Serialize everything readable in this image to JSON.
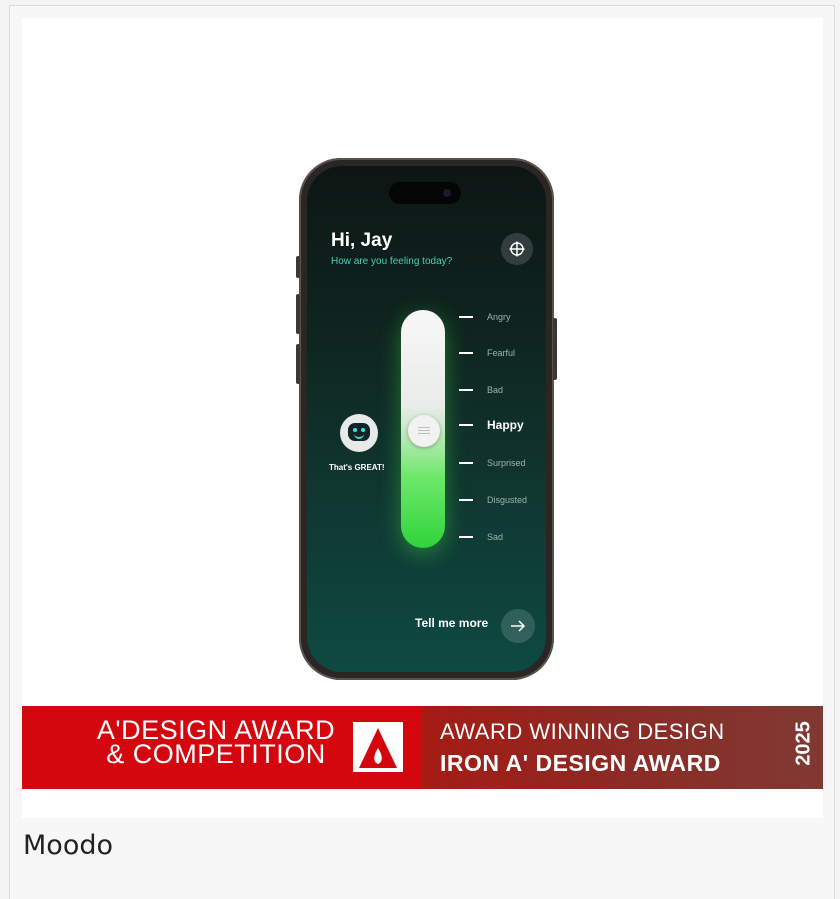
{
  "app": {
    "greeting": "Hi, Jay",
    "subtitle": "How are you feeling today?",
    "settings_icon": "crosshair-icon",
    "moods": [
      "Angry",
      "Fearful",
      "Bad",
      "Happy",
      "Surprised",
      "Disgusted",
      "Sad"
    ],
    "selected_mood": "Happy",
    "robot_caption": "That's GREAT!",
    "cta_label": "Tell me more",
    "cta_icon": "arrow-right-icon",
    "accent_color": "#46d0b8",
    "slider_color": "#2fd43a"
  },
  "banner": {
    "left_line1": "A'DESIGN AWARD",
    "left_line2": "& COMPETITION",
    "right_line1": "AWARD WINNING DESIGN",
    "right_line2": "IRON A' DESIGN AWARD",
    "year": "2025",
    "left_color": "#d4070f",
    "right_color": "#8c2a25"
  },
  "product": {
    "title": "Moodo"
  }
}
